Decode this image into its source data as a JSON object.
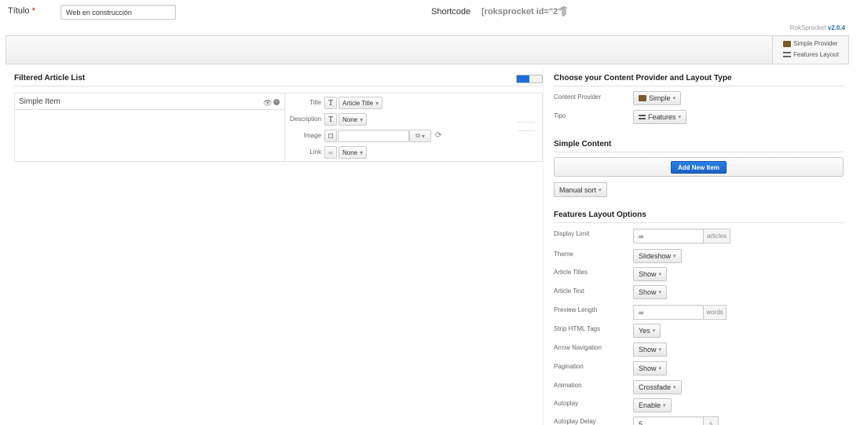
{
  "header": {
    "title_label": "Título",
    "required_mark": "*",
    "title_value": "Web en construcción",
    "shortcode_label": "Shortcode",
    "shortcode_value": "[roksprocket id=\"2\"]",
    "app_name": "RokSprocket",
    "version": "v2.0.4"
  },
  "summary": {
    "provider": "Simple Provider",
    "layout": "Features Layout"
  },
  "left": {
    "title": "Filtered Article List",
    "item": {
      "name": "Simple Item",
      "fields": {
        "title_label": "Title",
        "title_value": "Article Title",
        "description_label": "Description",
        "description_value": "None",
        "image_label": "Image",
        "link_label": "Link",
        "link_value": "None"
      }
    }
  },
  "right": {
    "provider_section_title": "Choose your Content Provider and Layout Type",
    "content_provider_label": "Content Provider",
    "content_provider_value": "Simple",
    "tipo_label": "Tipo",
    "tipo_value": "Features",
    "simple_content_title": "Simple Content",
    "add_new_item": "Add New Item",
    "manual_sort": "Manual sort",
    "features_title": "Features Layout Options",
    "options": {
      "display_limit_label": "Display Limit",
      "display_limit_value": "∞",
      "display_limit_unit": "articles",
      "theme_label": "Theme",
      "theme_value": "Slideshow",
      "article_titles_label": "Article Titles",
      "article_titles_value": "Show",
      "article_text_label": "Article Text",
      "article_text_value": "Show",
      "preview_length_label": "Preview Length",
      "preview_length_value": "∞",
      "preview_length_unit": "words",
      "strip_html_label": "Strip HTML Tags",
      "strip_html_value": "Yes",
      "arrow_nav_label": "Arrow Navigation",
      "arrow_nav_value": "Show",
      "pagination_label": "Pagination",
      "pagination_value": "Show",
      "animation_label": "Animation",
      "animation_value": "Crossfade",
      "autoplay_label": "Autoplay",
      "autoplay_value": "Enable",
      "autoplay_delay_label": "Autoplay Delay",
      "autoplay_delay_value": "5",
      "autoplay_delay_unit": "s"
    }
  },
  "colors": {
    "accent": "#1e6fd9",
    "required": "#c00",
    "version": "#2a6db5"
  }
}
